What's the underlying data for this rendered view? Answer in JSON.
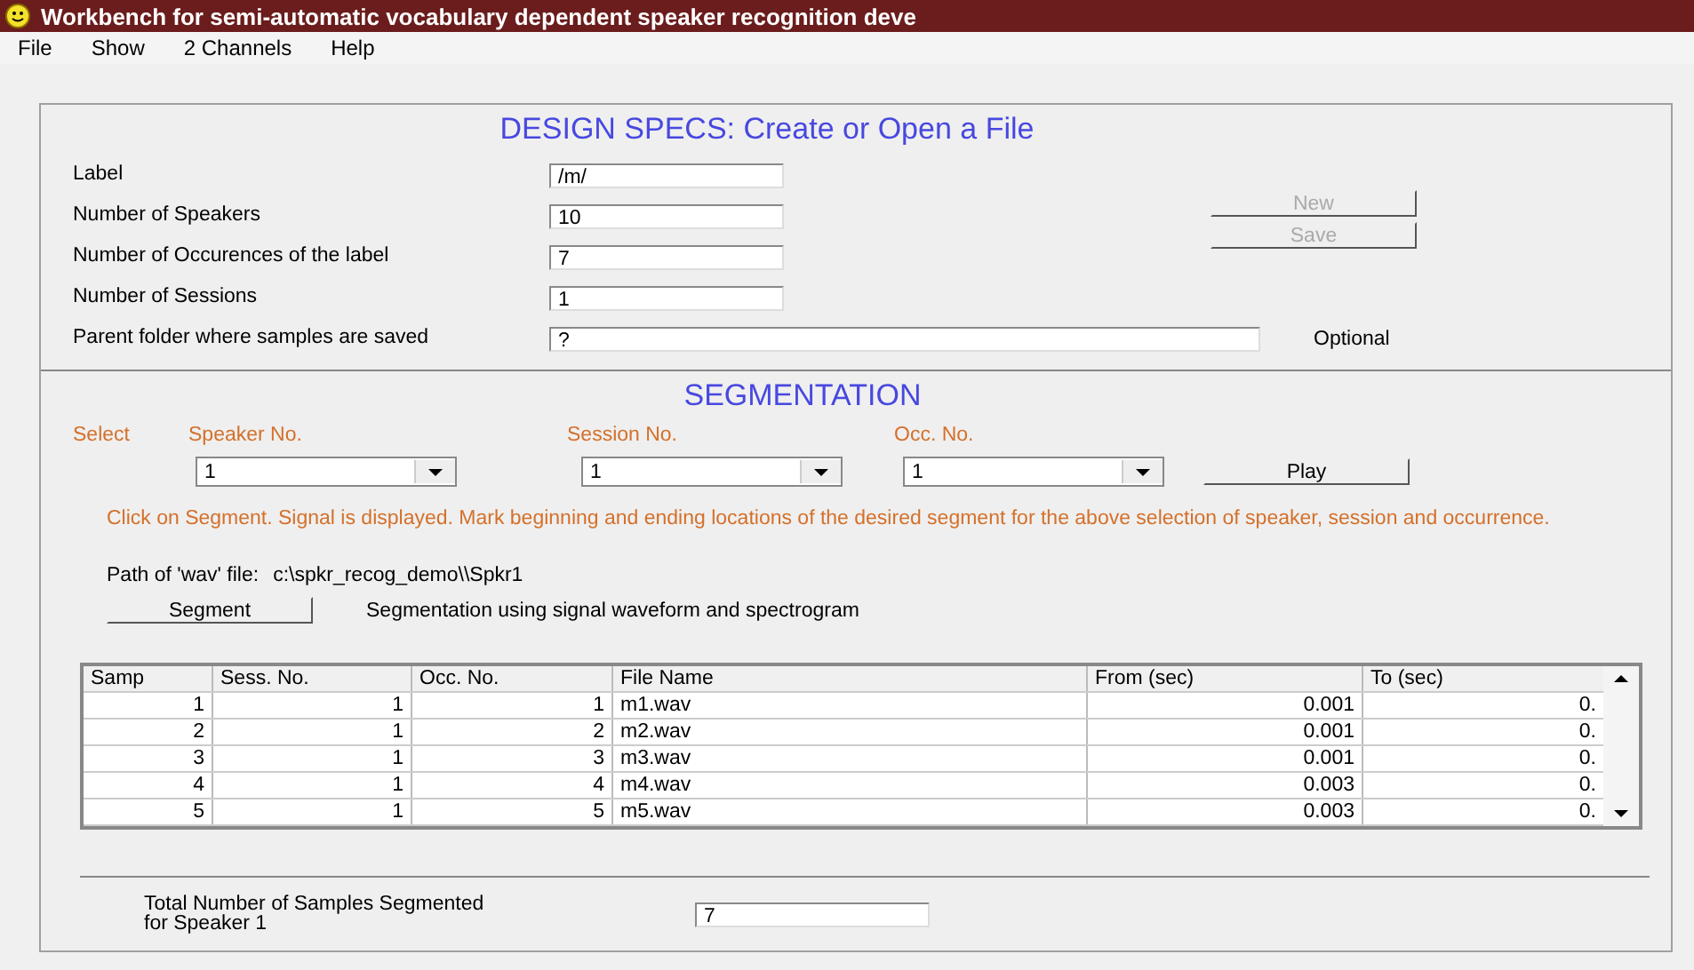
{
  "window": {
    "title": "Workbench for semi-automatic vocabulary dependent speaker recognition  deve"
  },
  "menu": [
    "File",
    "Show",
    "2 Channels",
    "Help"
  ],
  "design_specs": {
    "heading": "DESIGN SPECS: Create or Open a File",
    "fields": [
      {
        "label": "Label",
        "value": "/m/"
      },
      {
        "label": "Number of Speakers",
        "value": "10"
      },
      {
        "label": "Number of Occurences of the label",
        "value": "7"
      },
      {
        "label": "Number of Sessions",
        "value": "1"
      },
      {
        "label": "Parent folder where samples are saved",
        "value": "?",
        "note": "Optional"
      }
    ],
    "buttons": [
      {
        "label": "New",
        "disabled": true
      },
      {
        "label": "Save",
        "disabled": true
      }
    ]
  },
  "segmentation": {
    "heading": "SEGMENTATION",
    "select_label": "Select",
    "selectors": [
      {
        "label": "Speaker No.",
        "value": "1"
      },
      {
        "label": "Session No.",
        "value": "1"
      },
      {
        "label": "Occ. No.",
        "value": "1"
      }
    ],
    "play_button": "Play",
    "instructions": "Click on Segment. Signal is displayed. Mark beginning and ending locations of the desired segment for the above selection of speaker, session and occurrence.",
    "path_label": "Path of 'wav' file:",
    "path": "c:\\spkr_recog_demo\\\\Spkr1",
    "segment_button": "Segment",
    "segment_description": "Segmentation using signal waveform and spectrogram"
  },
  "table": {
    "columns": [
      "Samp",
      "Sess. No.",
      "Occ. No.",
      "File Name",
      "From (sec)",
      "To (sec)"
    ],
    "rows": [
      [
        "1",
        "1",
        "1",
        "m1.wav",
        "0.001",
        "0."
      ],
      [
        "2",
        "1",
        "2",
        "m2.wav",
        "0.001",
        "0."
      ],
      [
        "3",
        "1",
        "3",
        "m3.wav",
        "0.001",
        "0."
      ],
      [
        "4",
        "1",
        "4",
        "m4.wav",
        "0.003",
        "0."
      ],
      [
        "5",
        "1",
        "5",
        "m5.wav",
        "0.003",
        "0."
      ]
    ]
  },
  "total": {
    "label": "Total Number of Samples Segmented for Speaker 1",
    "value": "7"
  }
}
